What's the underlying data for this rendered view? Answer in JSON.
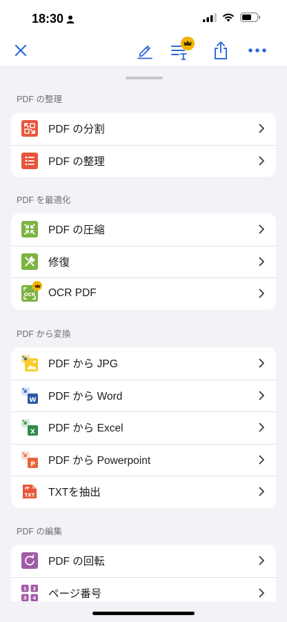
{
  "status": {
    "time": "18:30"
  },
  "colors": {
    "accent": "#2b68d9",
    "red": "#e8553b",
    "green": "#7cb342",
    "purple": "#a15ba6",
    "gold": "#f4b400"
  },
  "sections": [
    {
      "title": "PDF の整理",
      "items": [
        {
          "label": "PDF の分割",
          "icon": "split-icon"
        },
        {
          "label": "PDF の整理",
          "icon": "organize-icon"
        }
      ]
    },
    {
      "title": "PDF を最適化",
      "items": [
        {
          "label": "PDF の圧縮",
          "icon": "compress-icon"
        },
        {
          "label": "修復",
          "icon": "repair-icon"
        },
        {
          "label": "OCR PDF",
          "icon": "ocr-icon"
        }
      ]
    },
    {
      "title": "PDF から変換",
      "items": [
        {
          "label": "PDF から JPG",
          "icon": "jpg-icon"
        },
        {
          "label": "PDF から Word",
          "icon": "word-icon"
        },
        {
          "label": "PDF から Excel",
          "icon": "excel-icon"
        },
        {
          "label": "PDF から Powerpoint",
          "icon": "powerpoint-icon"
        },
        {
          "label": "TXTを抽出",
          "icon": "txt-icon"
        }
      ]
    },
    {
      "title": "PDF の編集",
      "items": [
        {
          "label": "PDF の回転",
          "icon": "rotate-icon"
        },
        {
          "label": "ページ番号",
          "icon": "page-number-icon"
        }
      ]
    }
  ]
}
